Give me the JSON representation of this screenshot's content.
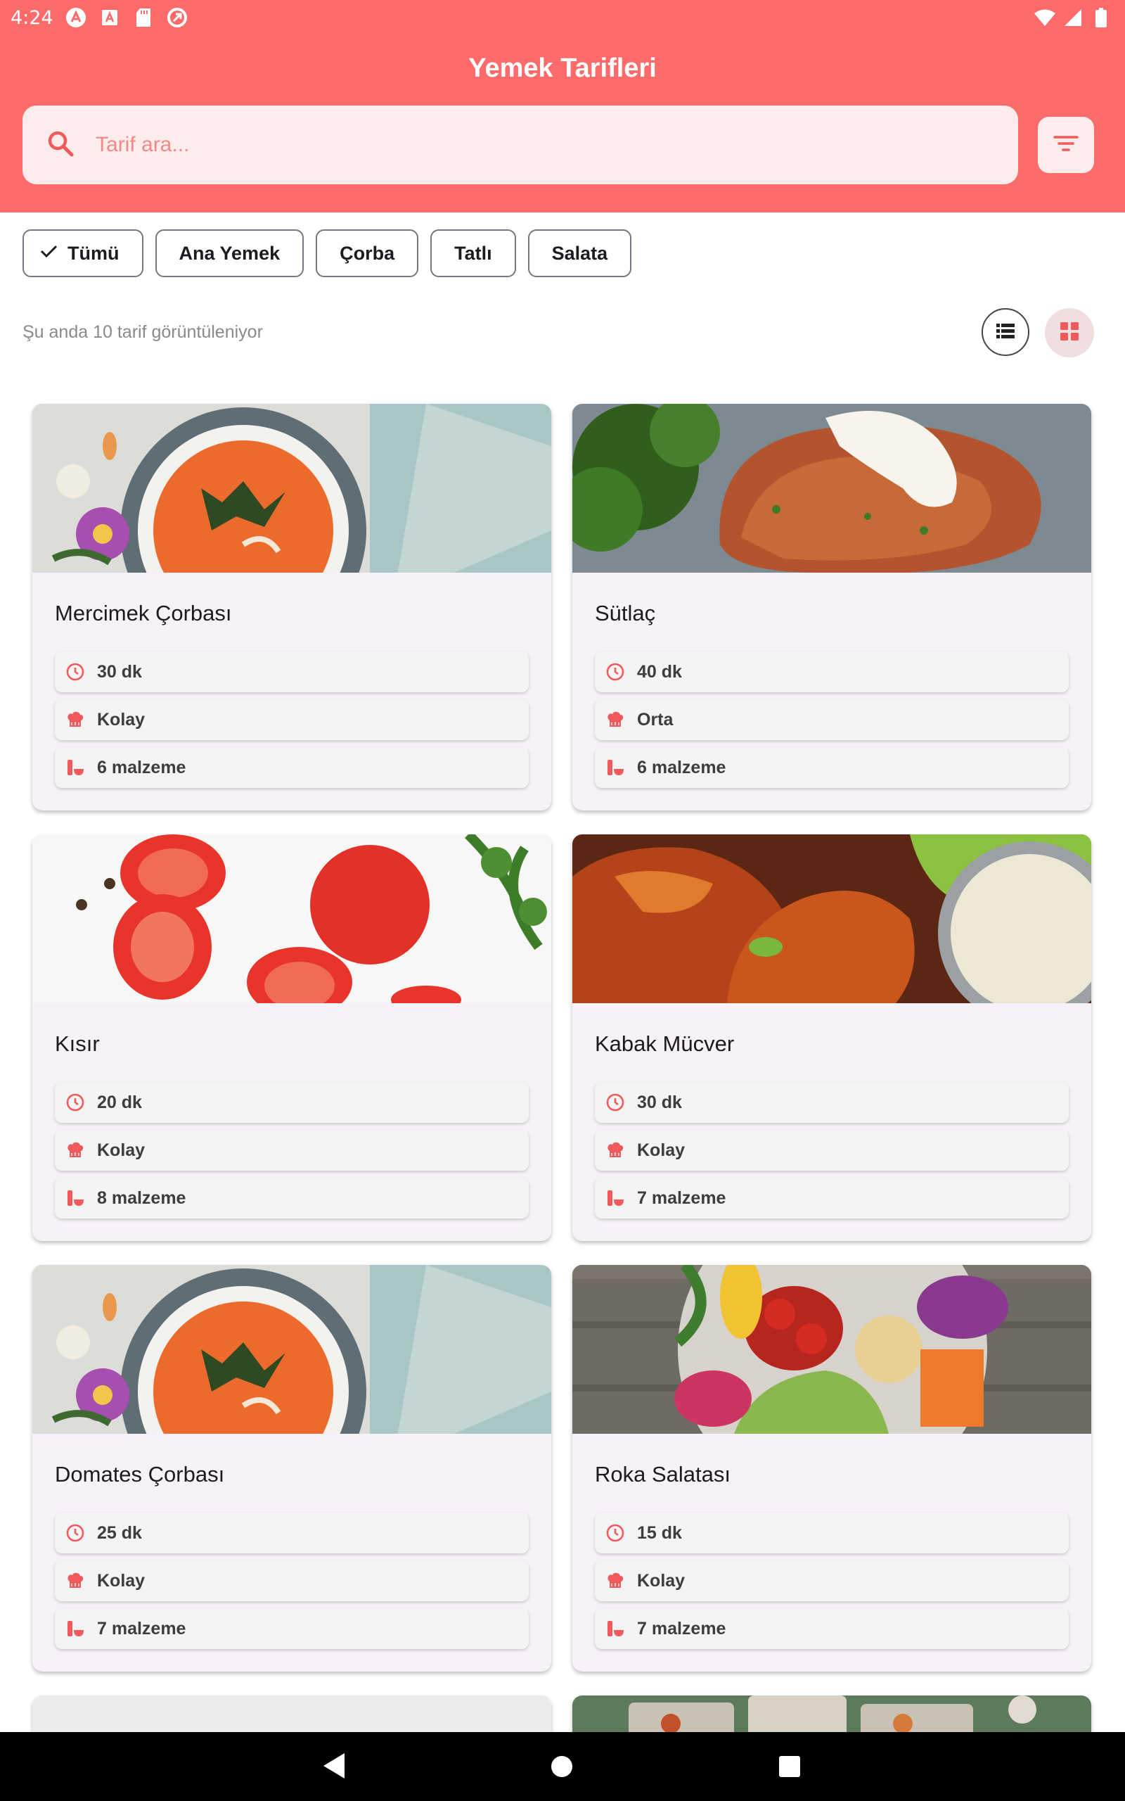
{
  "status": {
    "time": "4:24"
  },
  "app": {
    "title": "Yemek Tarifleri"
  },
  "search": {
    "placeholder": "Tarif ara...",
    "value": ""
  },
  "chips": [
    {
      "label": "Tümü",
      "selected": true
    },
    {
      "label": "Ana Yemek",
      "selected": false
    },
    {
      "label": "Çorba",
      "selected": false
    },
    {
      "label": "Tatlı",
      "selected": false
    },
    {
      "label": "Salata",
      "selected": false
    }
  ],
  "count_text": "Şu anda 10 tarif görüntüleniyor",
  "view_mode": "grid",
  "colors": {
    "primary": "#ff6b6b",
    "accent_icon": "#f05a5a",
    "card_bg": "#f6f2f7"
  },
  "recipes": [
    {
      "title": "Mercimek Çorbası",
      "time": "30 dk",
      "difficulty": "Kolay",
      "ingredients": "6 malzeme",
      "image": "soup-image"
    },
    {
      "title": "Sütlaç",
      "time": "40 dk",
      "difficulty": "Orta",
      "ingredients": "6 malzeme",
      "image": "meat-image"
    },
    {
      "title": "Kısır",
      "time": "20 dk",
      "difficulty": "Kolay",
      "ingredients": "8 malzeme",
      "image": "tomato-image"
    },
    {
      "title": "Kabak Mücver",
      "time": "30 dk",
      "difficulty": "Kolay",
      "ingredients": "7 malzeme",
      "image": "chicken-image"
    },
    {
      "title": "Domates Çorbası",
      "time": "25 dk",
      "difficulty": "Kolay",
      "ingredients": "7 malzeme",
      "image": "soup-image"
    },
    {
      "title": "Roka Salatası",
      "time": "15 dk",
      "difficulty": "Kolay",
      "ingredients": "7 malzeme",
      "image": "salad-image"
    }
  ]
}
